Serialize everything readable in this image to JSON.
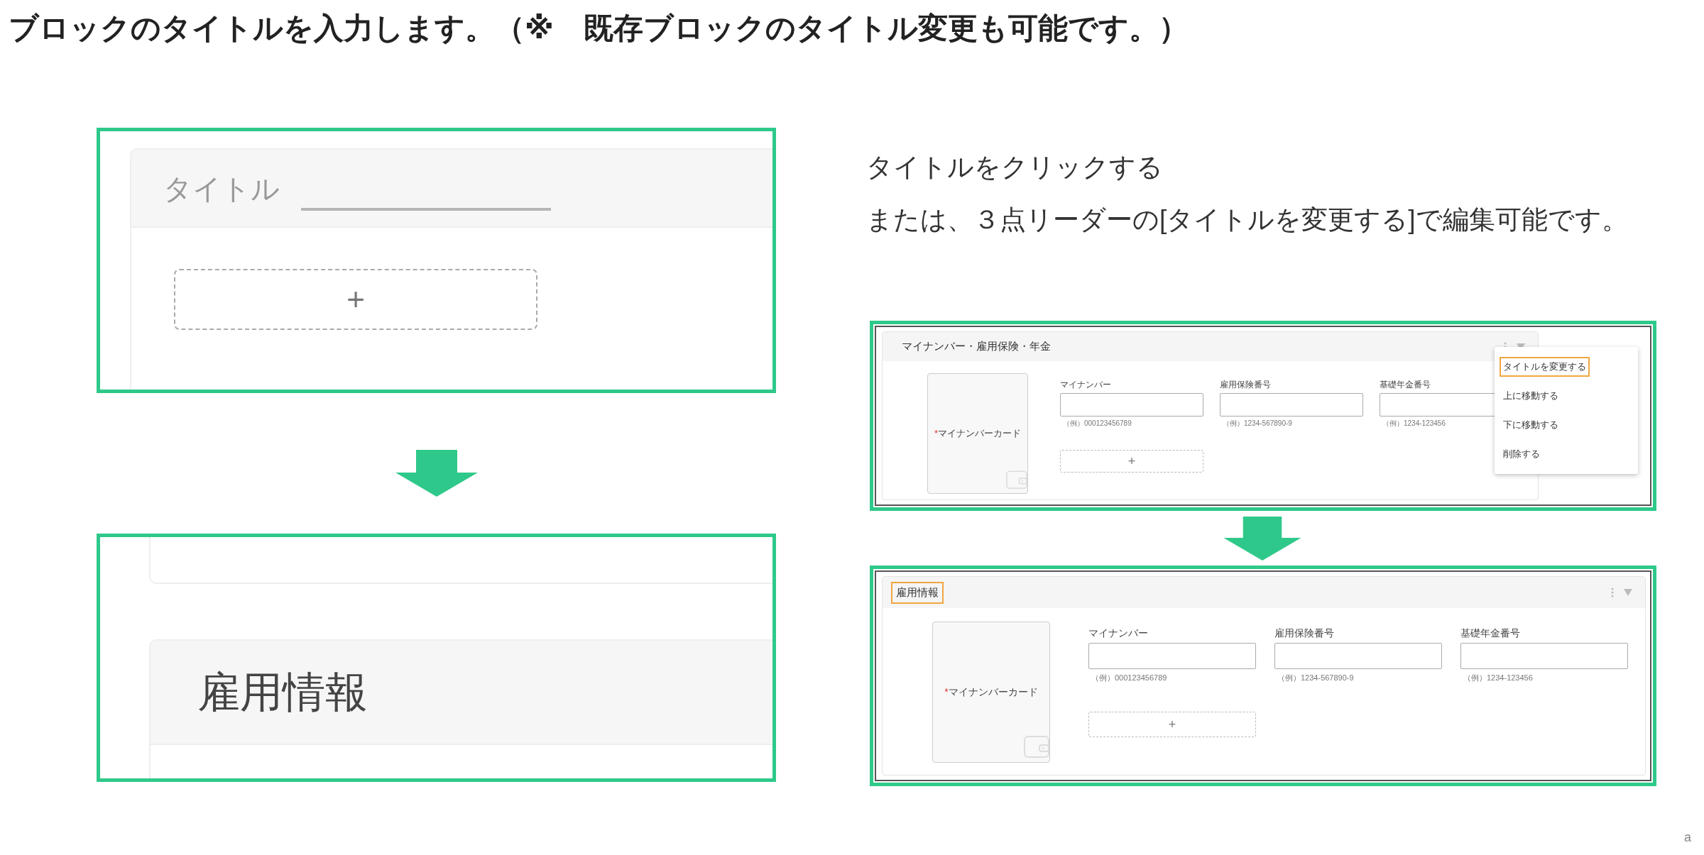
{
  "heading": "ブロックのタイトルを入力します。（※　既存ブロックのタイトル変更も可能です。）",
  "zoom_example": {
    "before": {
      "title_field": {
        "placeholder": "タイトル"
      },
      "add_button": "+"
    },
    "after": {
      "title": "雇用情報"
    }
  },
  "instructions": [
    "タイトルをクリックする",
    "または、３点リーダーの[タイトルを変更する]で編集可能です。"
  ],
  "menu_example": {
    "before": {
      "title": "マイナンバー・雇用保険・年金",
      "title_focused": false,
      "card": {
        "required_mark": "*",
        "label": "マイナンバーカード"
      },
      "fields": [
        {
          "label": "マイナンバー",
          "hint": "（例）000123456789"
        },
        {
          "label": "雇用保険番号",
          "hint": "（例）1234-567890-9"
        },
        {
          "label": "基礎年金番号",
          "hint": "（例）1234-123456"
        }
      ],
      "add_button": "+",
      "menu": {
        "items": [
          {
            "label": "タイトルを変更する",
            "selected": true
          },
          {
            "label": "上に移動する",
            "selected": false
          },
          {
            "label": "下に移動する",
            "selected": false
          },
          {
            "label": "削除する",
            "selected": false
          }
        ]
      }
    },
    "after": {
      "title": "雇用情報",
      "title_focused": true,
      "card": {
        "required_mark": "*",
        "label": "マイナンバーカード"
      },
      "fields": [
        {
          "label": "マイナンバー",
          "hint": "（例）000123456789"
        },
        {
          "label": "雇用保険番号",
          "hint": "（例）1234-567890-9"
        },
        {
          "label": "基礎年金番号",
          "hint": "（例）1234-123456"
        }
      ],
      "add_button": "+"
    }
  },
  "corner_mark": "a"
}
